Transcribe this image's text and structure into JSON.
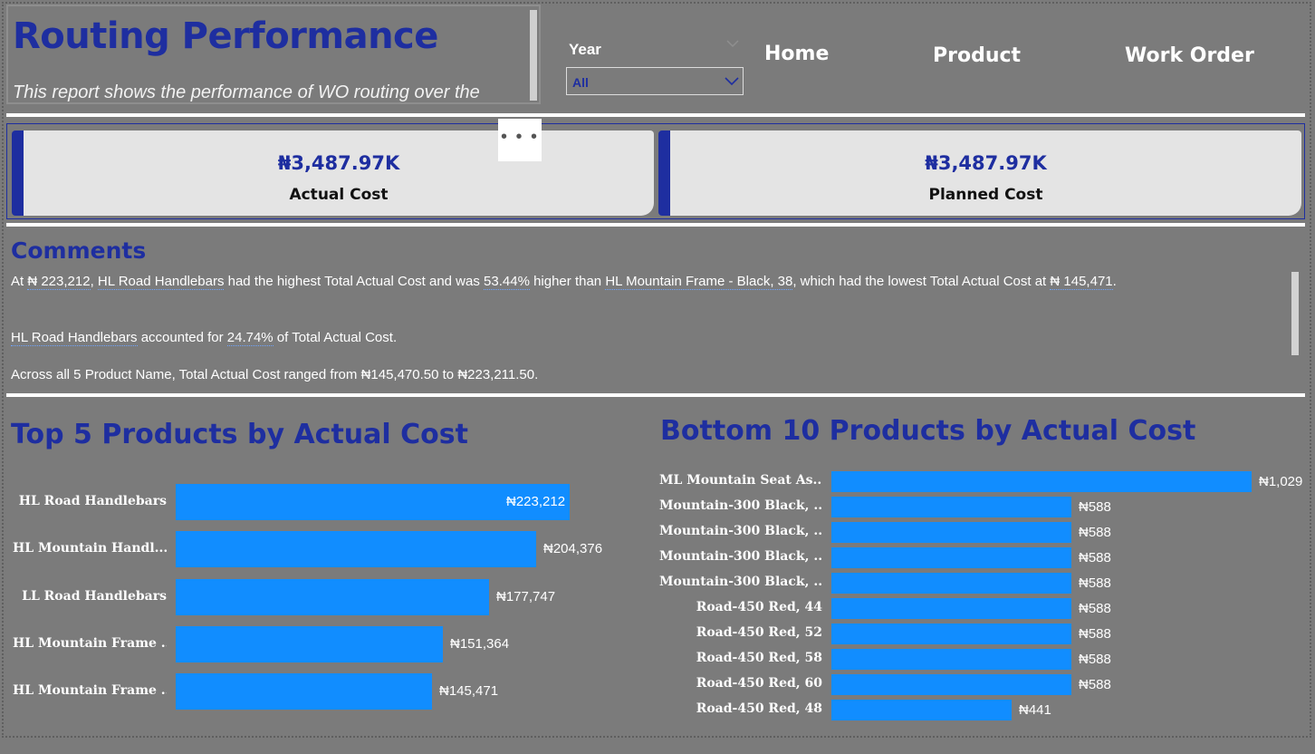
{
  "header": {
    "title": "Routing Performance",
    "subtitle": "This report shows the performance of WO routing over the"
  },
  "filter": {
    "label": "Year",
    "value": "All"
  },
  "nav": {
    "home": "Home",
    "product": "Product",
    "work_order": "Work Order"
  },
  "kpis": [
    {
      "value": "₦3,487.97K",
      "label": "Actual Cost"
    },
    {
      "value": "₦3,487.97K",
      "label": "Planned Cost"
    }
  ],
  "more_options": "• • •",
  "comments": {
    "title": "Comments",
    "line1": {
      "p1": "At ",
      "v1": "₦ 223,212",
      "p2": ", ",
      "v2": "HL Road Handlebars",
      "p3": " had the highest Total Actual Cost and was ",
      "v3": "53.44%",
      "p4": " higher than ",
      "v4": "HL Mountain Frame - Black, 38",
      "p5": ", which had the lowest Total Actual Cost at ",
      "v5": "₦ 145,471",
      "p6": "."
    },
    "line2": {
      "v1": "HL Road Handlebars",
      "p1": " accounted for ",
      "v2": "24.74%",
      "p2": " of Total Actual Cost."
    },
    "line3": "Across all 5 Product Name, Total Actual Cost ranged from ₦145,470.50 to ₦223,211.50."
  },
  "colors": {
    "background": "#7b7b7b",
    "accent": "#1e2ea0",
    "bar": "#118dff",
    "card": "#e4e4e4"
  },
  "chart_data": [
    {
      "type": "bar",
      "orientation": "horizontal",
      "title": "Top 5 Products by Actual Cost",
      "categories": [
        "HL Road Handlebars",
        "HL Mountain Handl...",
        "LL Road Handlebars",
        "HL Mountain Frame ...",
        "HL Mountain Frame ..."
      ],
      "values": [
        223212,
        204376,
        177747,
        151364,
        145471
      ],
      "data_labels": [
        "₦223,212",
        "₦204,376",
        "₦177,747",
        "₦151,364",
        "₦145,471"
      ],
      "xlim": [
        0,
        231000
      ]
    },
    {
      "type": "bar",
      "orientation": "horizontal",
      "title": "Bottom 10 Products by Actual Cost",
      "categories": [
        "ML Mountain Seat As...",
        "Mountain-300 Black, ...",
        "Mountain-300 Black, ...",
        "Mountain-300 Black, ...",
        "Mountain-300 Black, ...",
        "Road-450 Red, 44",
        "Road-450 Red, 52",
        "Road-450 Red, 58",
        "Road-450 Red, 60",
        "Road-450 Red, 48"
      ],
      "values": [
        1029,
        588,
        588,
        588,
        588,
        588,
        588,
        588,
        588,
        441
      ],
      "data_labels": [
        "₦1,029",
        "₦588",
        "₦588",
        "₦588",
        "₦588",
        "₦588",
        "₦588",
        "₦588",
        "₦588",
        "₦441"
      ],
      "xlim": [
        0,
        1029
      ]
    }
  ]
}
